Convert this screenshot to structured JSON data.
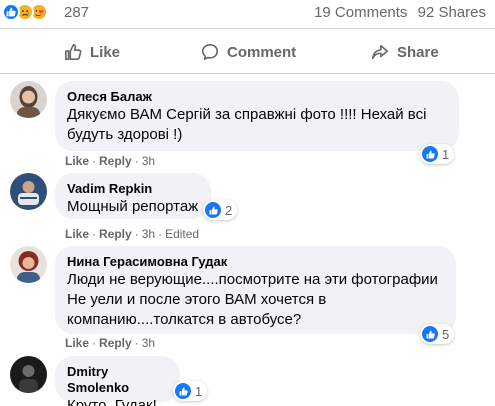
{
  "summary": {
    "reaction_count": "287",
    "comments": "19 Comments",
    "shares": "92 Shares",
    "reactions": [
      "like-icon",
      "sad-icon",
      "love-icon"
    ]
  },
  "actions": {
    "like": "Like",
    "comment": "Comment",
    "share": "Share"
  },
  "comments": [
    {
      "author": "Олеся Балаж",
      "text": "Дякуємо ВАМ Сергій за справжні фото !!!! Нехай всі будуть здорові !)",
      "like": "Like",
      "reply": "Reply",
      "time": "3h",
      "edited": "",
      "reactions": "1"
    },
    {
      "author": "Vadim Repkin",
      "text": "Мощный репортаж",
      "like": "Like",
      "reply": "Reply",
      "time": "3h",
      "edited": "Edited",
      "reactions": "2"
    },
    {
      "author": "Нина Герасимовна Гудак",
      "text": "Люди не верующие....посмотрите на эти фотографии Не уели и после этого ВАМ хочется в компанию....толкатся в автобусе?",
      "like": "Like",
      "reply": "Reply",
      "time": "3h",
      "edited": "",
      "reactions": "5"
    },
    {
      "author": "Dmitry Smolenko",
      "text": "Круто, Гудак!",
      "reactions": "1"
    }
  ],
  "colors": {
    "accent": "#1877f2",
    "muted": "#65676b",
    "bubble": "#f0f2f5"
  }
}
